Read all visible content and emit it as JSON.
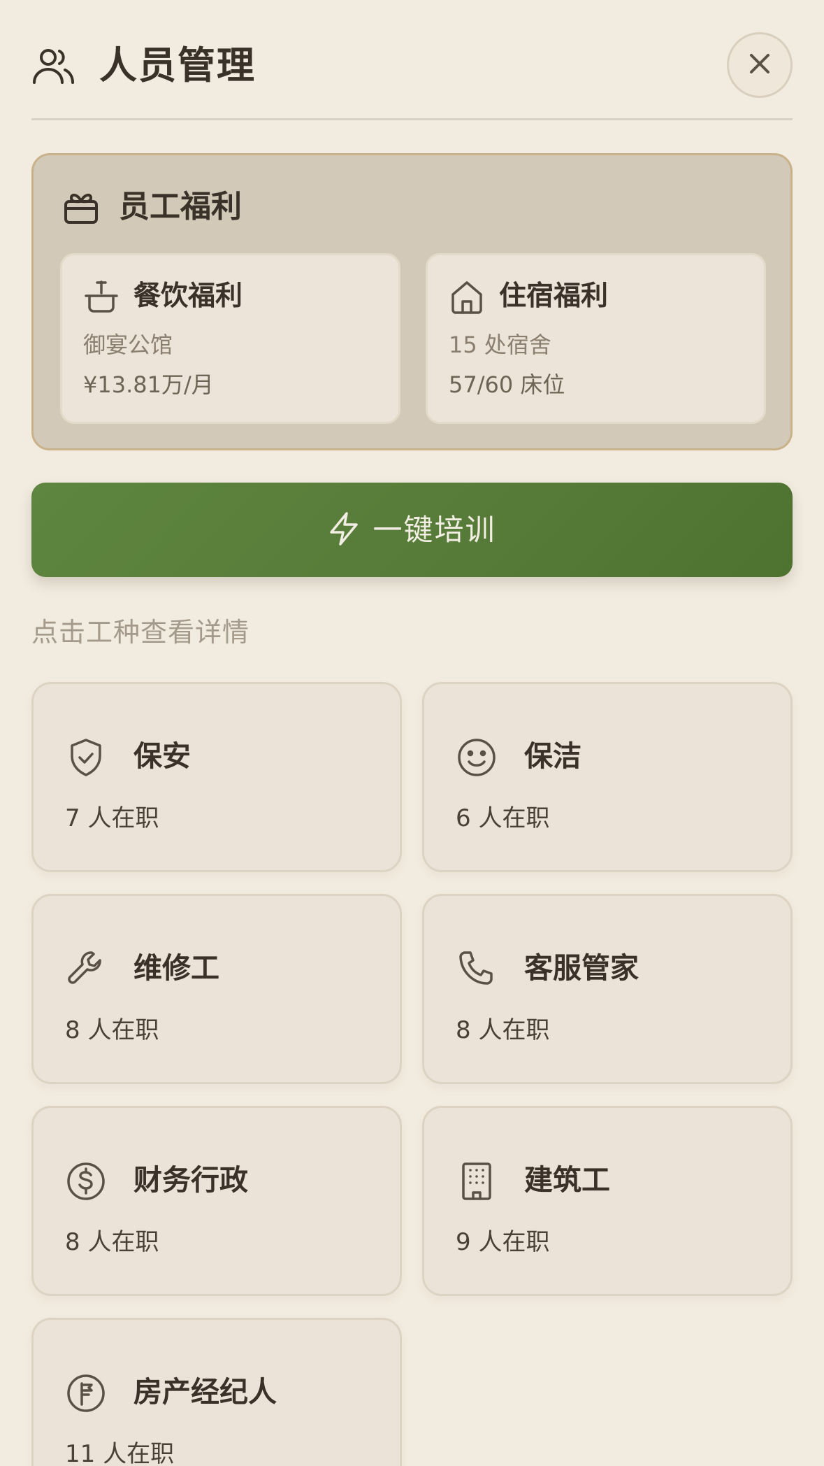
{
  "header": {
    "title": "人员管理",
    "icon": "users-icon",
    "close_icon": "close-icon"
  },
  "benefits": {
    "title": "员工福利",
    "icon": "gift-box-icon",
    "dining": {
      "title": "餐饮福利",
      "icon": "dining-basin-icon",
      "line1": "御宴公馆",
      "line2": "¥13.81万/月"
    },
    "housing": {
      "title": "住宿福利",
      "icon": "house-icon",
      "line1": "15 处宿舍",
      "line2": "57/60 床位"
    }
  },
  "training_button": {
    "label": "一键培训",
    "icon": "lightning-icon"
  },
  "hint": "点击工种查看详情",
  "jobs": [
    {
      "title": "保安",
      "count": "7 人在职",
      "icon": "shield-check-icon"
    },
    {
      "title": "保洁",
      "count": "6 人在职",
      "icon": "smiley-icon"
    },
    {
      "title": "维修工",
      "count": "8 人在职",
      "icon": "wrench-icon"
    },
    {
      "title": "客服管家",
      "count": "8 人在职",
      "icon": "phone-icon"
    },
    {
      "title": "财务行政",
      "count": "8 人在职",
      "icon": "coin-icon"
    },
    {
      "title": "建筑工",
      "count": "9 人在职",
      "icon": "building-icon"
    },
    {
      "title": "房产经纪人",
      "count": "11 人在职",
      "icon": "signpost-icon"
    }
  ],
  "colors": {
    "background": "#f2ebdf",
    "panel": "#d2c9b8",
    "panel_border": "#c9b28a",
    "card": "#ebe3d7",
    "accent_green": "#5a7f3b",
    "text_dark": "#3a3128",
    "text_muted": "#a39a8c"
  }
}
